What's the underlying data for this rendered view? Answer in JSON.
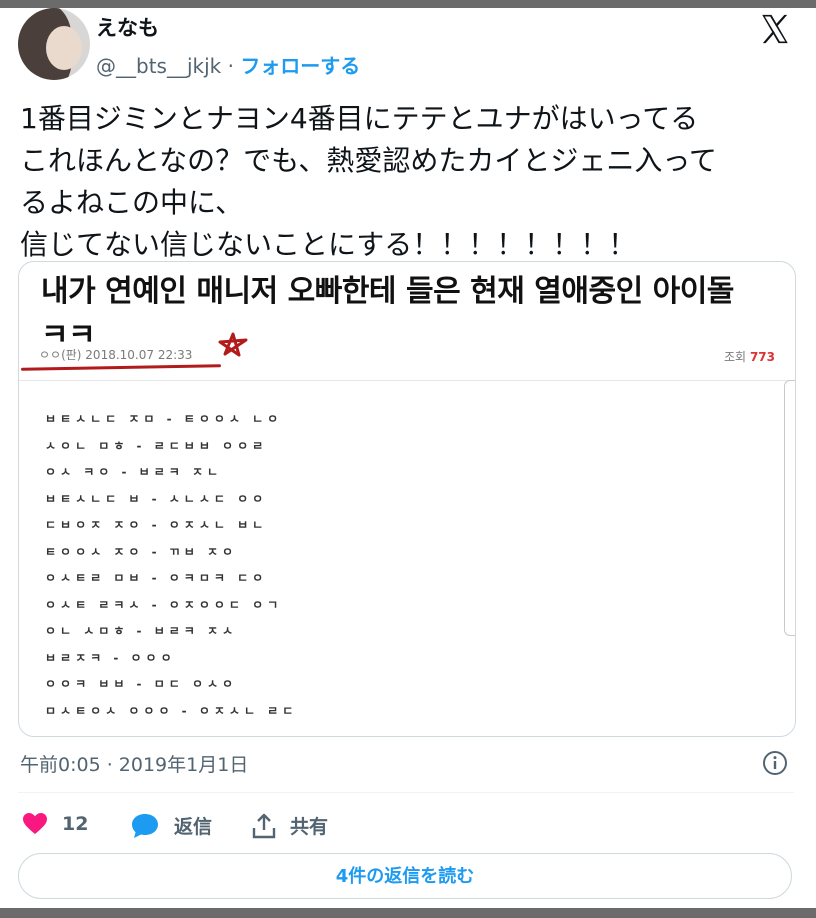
{
  "user": {
    "display_name": "えなも",
    "handle": "@__bts__jkjk",
    "separator": "·",
    "follow_label": "フォローする"
  },
  "tweet": {
    "lines": [
      "1番目ジミンとナヨン4番目にテテとユナがはいってる",
      "これほんとなの？でも、熱愛認めたカイとジェニ入って",
      "るよねこの中に、",
      "信じてない信じないことにする！！！！！！！！"
    ],
    "timestamp": "午前0:05 · 2019年1月1日"
  },
  "media": {
    "title_line1": "내가 연예인 매니저 오빠한테 들은 현재 열애중인 아이돌",
    "title_line2": "ㅋㅋ",
    "meta": "ㅇㅇ(판) 2018.10.07 22:33",
    "views_label": "조회",
    "views_count": "773",
    "code_lines": [
      "ㅂㅌㅅㄴㄷ ㅈㅁ - ㅌㅇㅇㅅ ㄴㅇ",
      "ㅅㅇㄴ ㅁㅎ - ㄹㄷㅂㅂ ㅇㅇㄹ",
      "ㅇㅅ ㅋㅇ - ㅂㄹㅋ ㅈㄴ",
      "ㅂㅌㅅㄴㄷ ㅂ - ㅅㄴㅅㄷ ㅇㅇ",
      "ㄷㅂㅇㅈ ㅈㅇ - ㅇㅈㅅㄴ ㅂㄴ",
      "ㅌㅇㅇㅅ ㅈㅇ - ㄲㅂ ㅈㅇ",
      "ㅇㅅㅌㄹ ㅁㅂ - ㅇㅋㅁㅋ ㄷㅇ",
      "ㅇㅅㅌ ㄹㅋㅅ - ㅇㅈㅇㅇㄷ ㅇㄱ",
      "ㅇㄴ ㅅㅁㅎ - ㅂㄹㅋ ㅈㅅ",
      "ㅂㄹㅈㅋ - ㅇㅇㅇ",
      "ㅇㅇㅋ ㅂㅂ - ㅁㄷ ㅇㅅㅇ",
      "ㅁㅅㅌㅇㅅ ㅇㅇㅇ - ㅇㅈㅅㄴ ㄹㄷ"
    ]
  },
  "actions": {
    "like_count": "12",
    "reply_label": "返信",
    "share_label": "共有",
    "read_replies_label": "4件の返信を読む"
  },
  "colors": {
    "accent": "#1d9bf0",
    "like": "#f91880",
    "muted": "#536471",
    "annotation_red": "#b21b1b"
  },
  "icons": [
    "x-logo-icon",
    "info-icon",
    "heart-icon",
    "reply-bubble-icon",
    "share-icon",
    "star-scribble-icon"
  ]
}
